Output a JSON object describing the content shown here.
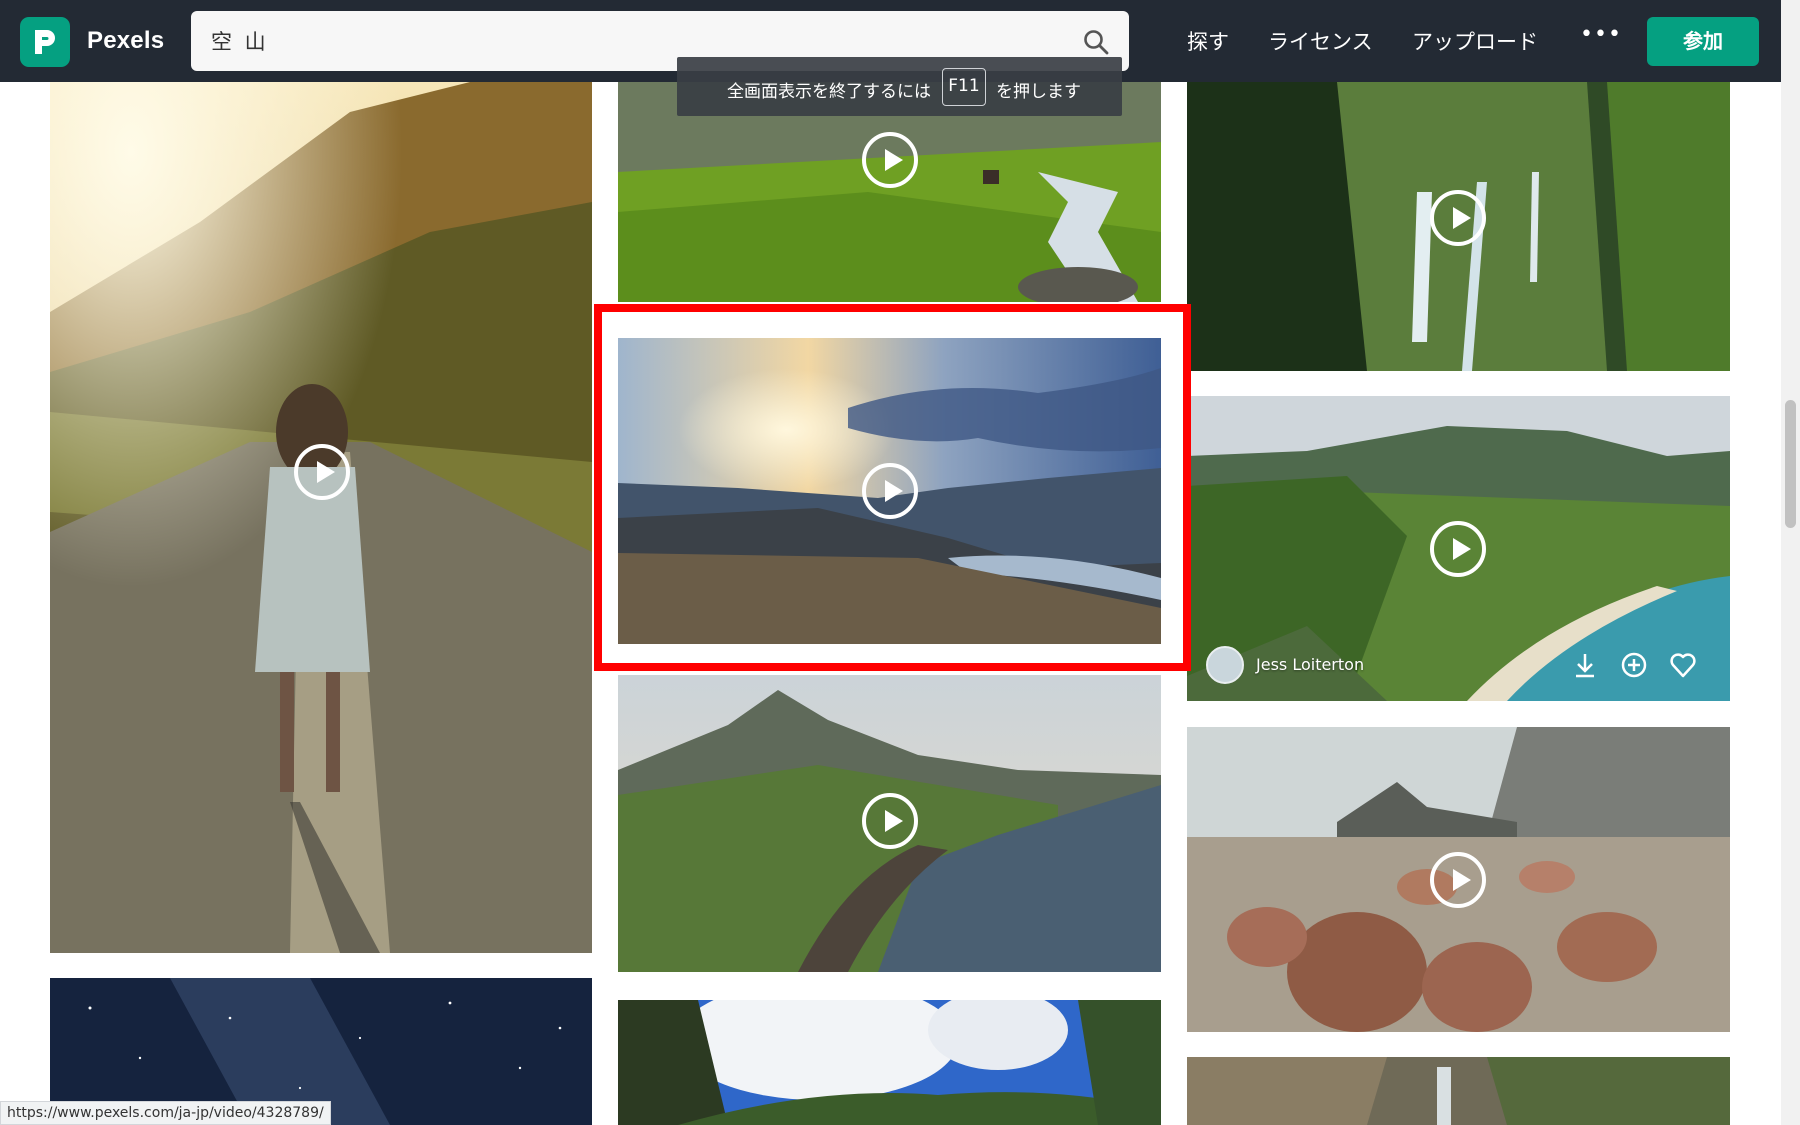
{
  "header": {
    "logo_text": "Pexels",
    "search_value": "空 山",
    "nav": [
      "探す",
      "ライセンス",
      "アップロード"
    ],
    "more_label": "•••",
    "join_label": "参加"
  },
  "fullscreen_notice": {
    "before": "全画面表示を終了するには",
    "key": "F11",
    "after": "を押します"
  },
  "tiles": [
    {
      "name": "road-woman-sunset-video",
      "play_icon": "play-icon"
    },
    {
      "name": "meadow-stream-video",
      "play_icon": "play-icon"
    },
    {
      "name": "sunset-lake-mountains-video",
      "play_icon": "play-icon",
      "highlighted": true
    },
    {
      "name": "coastal-peak-video",
      "play_icon": "play-icon"
    },
    {
      "name": "waterfall-cliffs-video",
      "play_icon": "play-icon"
    },
    {
      "name": "green-valley-beach-video",
      "play_icon": "play-icon"
    },
    {
      "name": "boulder-bay-video",
      "play_icon": "play-icon"
    }
  ],
  "hover_card": {
    "author": "Jess Loiterton",
    "actions": [
      "download-icon",
      "add-collection-icon",
      "heart-icon"
    ]
  },
  "status_url": "https://www.pexels.com/ja-jp/video/4328789/",
  "colors": {
    "brand": "#05a081",
    "header_bg": "#232a34",
    "highlight": "#ff0000"
  }
}
